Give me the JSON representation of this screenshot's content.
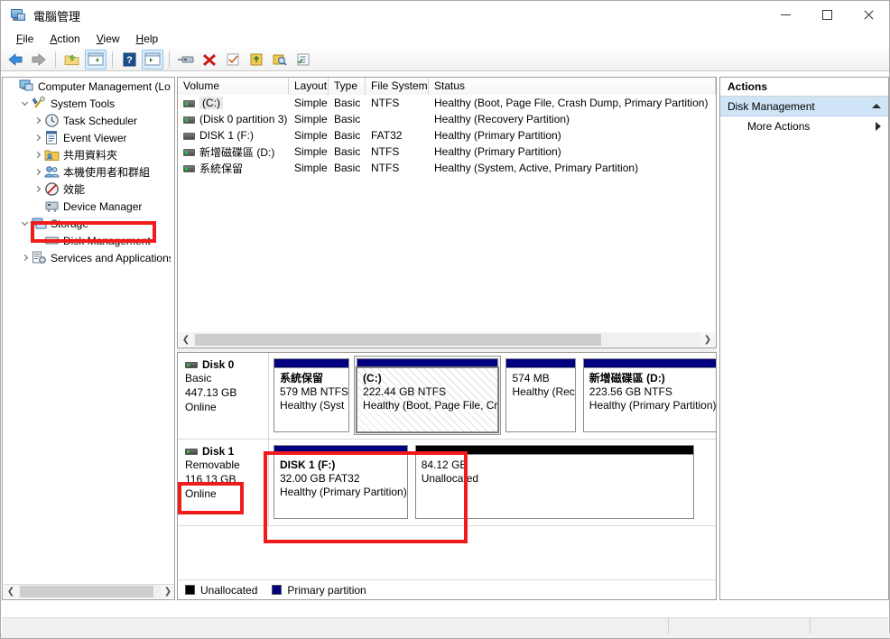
{
  "window": {
    "title": "電腦管理",
    "icon": "computer-management-icon",
    "controls": {
      "minimize": "minimize-icon",
      "maximize": "maximize-icon",
      "close": "close-icon"
    }
  },
  "menubar": {
    "items": [
      {
        "label": "File",
        "mnemonic": "F"
      },
      {
        "label": "Action",
        "mnemonic": "A"
      },
      {
        "label": "View",
        "mnemonic": "V"
      },
      {
        "label": "Help",
        "mnemonic": "H"
      }
    ]
  },
  "toolbar": {
    "buttons": [
      {
        "name": "back-icon",
        "glyph": "◀"
      },
      {
        "name": "forward-icon",
        "glyph": "▶"
      },
      {
        "name": "separator-1",
        "glyph": ""
      },
      {
        "name": "up-folder-icon",
        "glyph": ""
      },
      {
        "name": "show-hide-console-tree-icon",
        "glyph": ""
      },
      {
        "name": "separator-2",
        "glyph": ""
      },
      {
        "name": "help-icon",
        "glyph": "?"
      },
      {
        "name": "show-hide-action-pane-icon",
        "glyph": ""
      },
      {
        "name": "separator-3",
        "glyph": ""
      },
      {
        "name": "properties-icon",
        "glyph": ""
      },
      {
        "name": "delete-icon",
        "glyph": "✖"
      },
      {
        "name": "check-icon",
        "glyph": ""
      },
      {
        "name": "export-icon",
        "glyph": ""
      },
      {
        "name": "search-icon",
        "glyph": ""
      },
      {
        "name": "list-icon",
        "glyph": ""
      }
    ]
  },
  "tree": {
    "items": [
      {
        "label": "Computer Management (Local",
        "depth": 0,
        "expander": "none",
        "icon": "computer-management-icon"
      },
      {
        "label": "System Tools",
        "depth": 1,
        "expander": "down",
        "icon": "system-tools-icon"
      },
      {
        "label": "Task Scheduler",
        "depth": 2,
        "expander": "right",
        "icon": "clock-icon"
      },
      {
        "label": "Event Viewer",
        "depth": 2,
        "expander": "right",
        "icon": "event-viewer-icon"
      },
      {
        "label": "共用資料夾",
        "depth": 2,
        "expander": "right",
        "icon": "shared-folders-icon"
      },
      {
        "label": "本機使用者和群組",
        "depth": 2,
        "expander": "right",
        "icon": "local-users-groups-icon"
      },
      {
        "label": "效能",
        "depth": 2,
        "expander": "right",
        "icon": "performance-icon"
      },
      {
        "label": "Device Manager",
        "depth": 2,
        "expander": "none",
        "icon": "device-manager-icon"
      },
      {
        "label": "Storage",
        "depth": 1,
        "expander": "down",
        "icon": "storage-icon"
      },
      {
        "label": "Disk Management",
        "depth": 2,
        "expander": "none",
        "icon": "disk-management-icon"
      },
      {
        "label": "Services and Applications",
        "depth": 1,
        "expander": "right",
        "icon": "services-icon"
      }
    ]
  },
  "volume_list": {
    "columns": [
      "Volume",
      "Layout",
      "Type",
      "File System",
      "Status"
    ],
    "rows": [
      {
        "volume": "(C:)",
        "layout": "Simple",
        "type": "Basic",
        "fs": "NTFS",
        "status": "Healthy (Boot, Page File, Crash Dump, Primary Partition)",
        "selected": true,
        "icon": "volume-icon-green"
      },
      {
        "volume": "(Disk 0 partition 3)",
        "layout": "Simple",
        "type": "Basic",
        "fs": "",
        "status": "Healthy (Recovery Partition)",
        "selected": false,
        "icon": "volume-icon-green"
      },
      {
        "volume": "DISK 1 (F:)",
        "layout": "Simple",
        "type": "Basic",
        "fs": "FAT32",
        "status": "Healthy (Primary Partition)",
        "selected": false,
        "icon": "volume-icon-plain"
      },
      {
        "volume": "新增磁碟區 (D:)",
        "layout": "Simple",
        "type": "Basic",
        "fs": "NTFS",
        "status": "Healthy (Primary Partition)",
        "selected": false,
        "icon": "volume-icon-green"
      },
      {
        "volume": "系統保留",
        "layout": "Simple",
        "type": "Basic",
        "fs": "NTFS",
        "status": "Healthy (System, Active, Primary Partition)",
        "selected": false,
        "icon": "volume-icon-green"
      }
    ]
  },
  "graphical_view": {
    "disks": [
      {
        "name": "Disk 0",
        "type": "Basic",
        "capacity": "447.13 GB",
        "state": "Online",
        "partitions": [
          {
            "name": "系統保留",
            "size_fs": "579 MB NTFS",
            "status": "Healthy (Syst",
            "kind": "primary",
            "selected": false
          },
          {
            "name": "(C:)",
            "size_fs": "222.44 GB NTFS",
            "status": "Healthy (Boot, Page File, Cr",
            "kind": "primary",
            "selected": true
          },
          {
            "name": "",
            "size_fs": "574 MB",
            "status": "Healthy (Rec",
            "kind": "primary",
            "selected": false
          },
          {
            "name": "新增磁碟區  (D:)",
            "size_fs": "223.56 GB NTFS",
            "status": "Healthy (Primary Partition)",
            "kind": "primary",
            "selected": false
          }
        ]
      },
      {
        "name": "Disk 1",
        "type": "Removable",
        "capacity": "116.13 GB",
        "state": "Online",
        "partitions": [
          {
            "name": "DISK 1  (F:)",
            "size_fs": "32.00 GB FAT32",
            "status": "Healthy (Primary Partition)",
            "kind": "primary",
            "selected": false
          },
          {
            "name": "",
            "size_fs": "84.12 GB",
            "status": "Unallocated",
            "kind": "unallocated",
            "selected": false
          }
        ]
      }
    ],
    "legend": [
      {
        "swatch": "black",
        "label": "Unallocated"
      },
      {
        "swatch": "blue",
        "label": "Primary partition"
      }
    ]
  },
  "actions": {
    "title": "Actions",
    "group": "Disk Management",
    "items": [
      "More Actions"
    ]
  },
  "annotations": {
    "color": "#f01c1c",
    "boxes": [
      "disk-management-tree-item",
      "disk1-capacity-online",
      "disk1-partition-f"
    ]
  }
}
